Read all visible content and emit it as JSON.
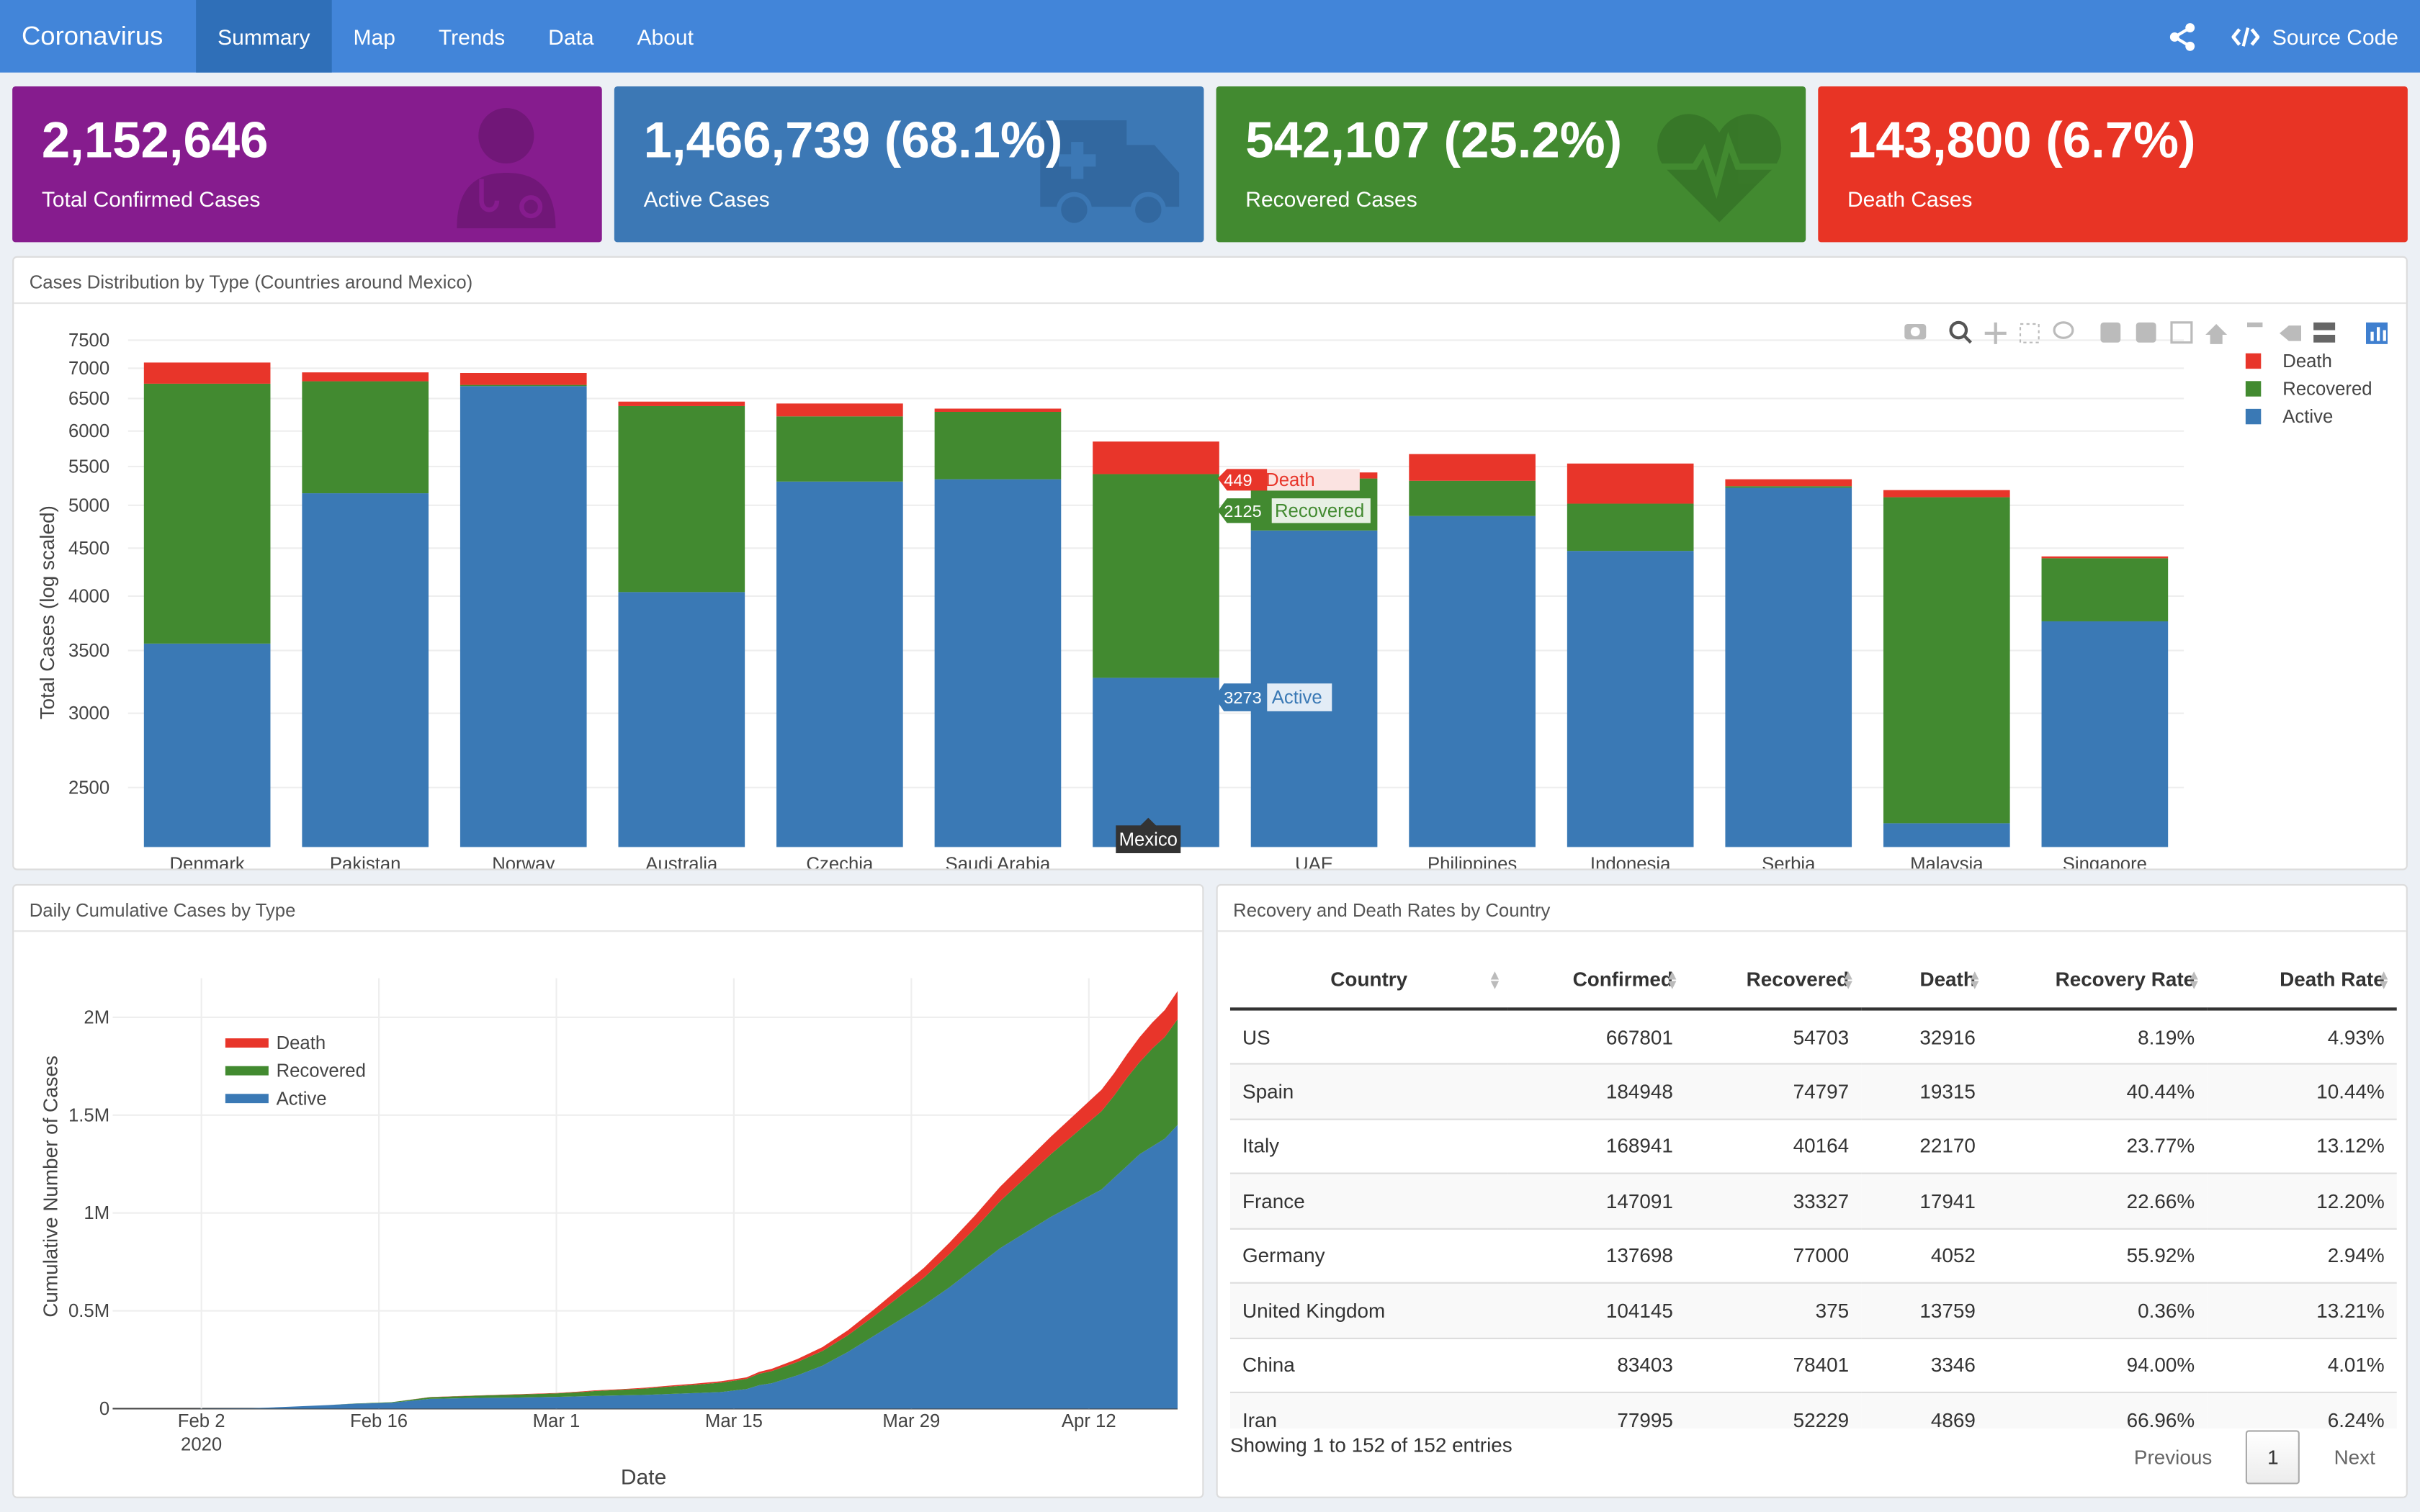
{
  "nav": {
    "brand": "Coronavirus",
    "tabs": [
      "Summary",
      "Map",
      "Trends",
      "Data",
      "About"
    ],
    "source_code": "Source Code"
  },
  "value_boxes": [
    {
      "value": "2,152,646",
      "label": "Total Confirmed Cases",
      "color": "#861c8e",
      "icon": "doctor-icon"
    },
    {
      "value": "1,466,739 (68.1%)",
      "label": "Active Cases",
      "color": "#3c78b5",
      "icon": "ambulance-icon"
    },
    {
      "value": "542,107 (25.2%)",
      "label": "Recovered Cases",
      "color": "#428a30",
      "icon": "heartbeat-icon"
    },
    {
      "value": "143,800 (6.7%)",
      "label": "Death Cases",
      "color": "#e83425",
      "icon": "skull-icon"
    }
  ],
  "bar_panel": {
    "title": "Cases Distribution by Type (Countries around Mexico)",
    "hover_death": "449",
    "hover_recovered": "2125",
    "hover_active": "3273",
    "hover_death_label": "Death",
    "hover_recovered_label": "Recovered",
    "hover_active_label": "Active",
    "hover_x": "Mexico"
  },
  "area_panel": {
    "title": "Daily Cumulative Cases by Type"
  },
  "table_panel": {
    "title": "Recovery and Death Rates by Country",
    "columns": [
      "Country",
      "Confirmed",
      "Recovered",
      "Death",
      "Recovery Rate",
      "Death Rate"
    ],
    "rows": [
      [
        "US",
        "667801",
        "54703",
        "32916",
        "8.19%",
        "4.93%"
      ],
      [
        "Spain",
        "184948",
        "74797",
        "19315",
        "40.44%",
        "10.44%"
      ],
      [
        "Italy",
        "168941",
        "40164",
        "22170",
        "23.77%",
        "13.12%"
      ],
      [
        "France",
        "147091",
        "33327",
        "17941",
        "22.66%",
        "12.20%"
      ],
      [
        "Germany",
        "137698",
        "77000",
        "4052",
        "55.92%",
        "2.94%"
      ],
      [
        "United Kingdom",
        "104145",
        "375",
        "13759",
        "0.36%",
        "13.21%"
      ],
      [
        "China",
        "83403",
        "78401",
        "3346",
        "94.00%",
        "4.01%"
      ],
      [
        "Iran",
        "77995",
        "52229",
        "4869",
        "66.96%",
        "6.24%"
      ]
    ],
    "info": "Showing 1 to 152 of 152 entries",
    "previous": "Previous",
    "current_page": "1",
    "next": "Next"
  },
  "colors": {
    "death": "#e8352a",
    "recovered": "#428a30",
    "active": "#3a79b5"
  },
  "chart_data": [
    {
      "type": "bar",
      "stacked": true,
      "ylabel": "Total Cases (log scaled)",
      "log_y": true,
      "ylim": [
        2160,
        7600
      ],
      "y_ticks": [
        2500,
        3000,
        3500,
        4000,
        4500,
        5000,
        5500,
        6000,
        6500,
        7000,
        7500
      ],
      "categories": [
        "Denmark",
        "Pakistan",
        "Norway",
        "Australia",
        "Czechia",
        "Saudi Arabia",
        "Mexico",
        "UAE",
        "Philippines",
        "Indonesia",
        "Serbia",
        "Malaysia",
        "Singapore"
      ],
      "series": [
        {
          "name": "Active",
          "values": [
            3560,
            5150,
            6700,
            4040,
            5300,
            5330,
            3273,
            4700,
            4870,
            4470,
            5220,
            2290,
            3760
          ]
        },
        {
          "name": "Recovered",
          "values": [
            3180,
            1630,
            20,
            2340,
            920,
            960,
            2125,
            640,
            440,
            550,
            20,
            2810,
            630
          ]
        },
        {
          "name": "Death",
          "values": [
            360,
            150,
            200,
            70,
            200,
            50,
            449,
            80,
            360,
            520,
            90,
            90,
            20
          ]
        }
      ],
      "legend": [
        "Death",
        "Recovered",
        "Active"
      ],
      "legend_position": "top-right"
    },
    {
      "type": "area",
      "stacked": true,
      "xlabel": "Date",
      "ylabel": "Cumulative Number of Cases",
      "x_ticks": [
        "Feb 2",
        "Feb 16",
        "Mar 1",
        "Mar 15",
        "Mar 29",
        "Apr 12"
      ],
      "x_tick_sub": "2020",
      "y_ticks": [
        "0",
        "0.5M",
        "1M",
        "1.5M",
        "2M"
      ],
      "ylim": [
        0,
        2.2
      ],
      "x": [
        0,
        6,
        11,
        14,
        17,
        19,
        22,
        25,
        29,
        32,
        35,
        37,
        38,
        40,
        42,
        44,
        46,
        48,
        50,
        51,
        52,
        54,
        56,
        58,
        60,
        62,
        64,
        66,
        68,
        70,
        72,
        74,
        76,
        78,
        79,
        80,
        81,
        82,
        83,
        84
      ],
      "series": [
        {
          "name": "Active",
          "values": [
            0,
            0,
            0.002,
            0.01,
            0.018,
            0.025,
            0.03,
            0.05,
            0.055,
            0.057,
            0.06,
            0.063,
            0.065,
            0.068,
            0.07,
            0.075,
            0.08,
            0.085,
            0.1,
            0.12,
            0.13,
            0.17,
            0.22,
            0.29,
            0.37,
            0.45,
            0.53,
            0.62,
            0.72,
            0.82,
            0.9,
            0.98,
            1.05,
            1.12,
            1.18,
            1.24,
            1.3,
            1.34,
            1.38,
            1.45
          ]
        },
        {
          "name": "Recovered",
          "values": [
            0,
            0,
            0,
            0,
            0,
            0.001,
            0.003,
            0.008,
            0.012,
            0.015,
            0.018,
            0.022,
            0.025,
            0.028,
            0.033,
            0.038,
            0.042,
            0.048,
            0.052,
            0.058,
            0.062,
            0.068,
            0.075,
            0.085,
            0.1,
            0.12,
            0.14,
            0.17,
            0.2,
            0.24,
            0.28,
            0.32,
            0.36,
            0.4,
            0.42,
            0.45,
            0.47,
            0.5,
            0.52,
            0.54
          ]
        },
        {
          "name": "Death",
          "values": [
            0,
            0,
            0,
            0,
            0,
            0,
            0,
            0.001,
            0.001,
            0.002,
            0.002,
            0.003,
            0.003,
            0.003,
            0.004,
            0.005,
            0.006,
            0.007,
            0.008,
            0.01,
            0.012,
            0.015,
            0.02,
            0.026,
            0.034,
            0.042,
            0.05,
            0.058,
            0.066,
            0.074,
            0.082,
            0.09,
            0.1,
            0.11,
            0.115,
            0.12,
            0.128,
            0.133,
            0.138,
            0.144
          ]
        }
      ],
      "legend": [
        "Death",
        "Recovered",
        "Active"
      ],
      "legend_position": "top-left"
    }
  ]
}
